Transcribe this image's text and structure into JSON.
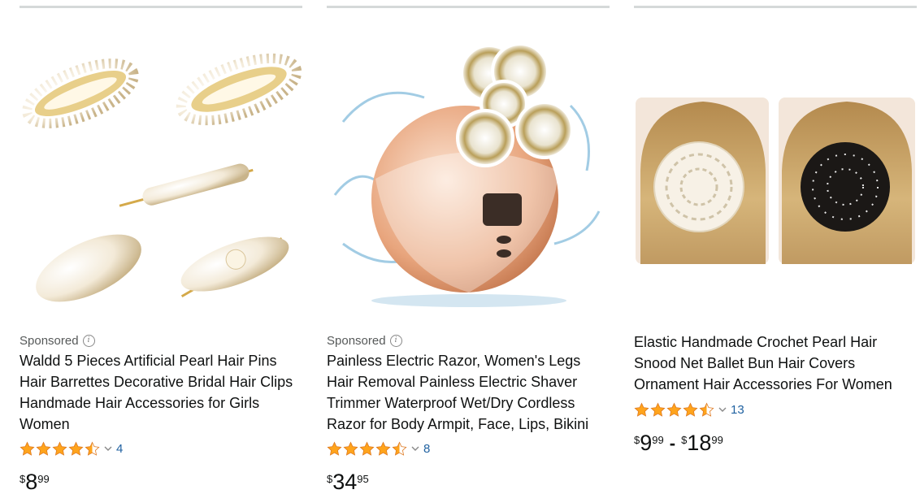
{
  "products": [
    {
      "sponsored_label": "Sponsored",
      "title": "Waldd 5 Pieces Artificial Pearl Hair Pins Hair Barrettes Decorative Bridal Hair Clips Handmade Hair Accessories for Girls Women",
      "rating": 4.5,
      "review_count": "4",
      "price": {
        "symbol": "$",
        "whole": "8",
        "fraction": "99"
      },
      "image_icon": "pearl-hair-clips-image"
    },
    {
      "sponsored_label": "Sponsored",
      "title": "Painless Electric Razor, Women's Legs Hair Removal Painless Electric Shaver Trimmer Waterproof Wet/Dry Cordless Razor for Body Armpit, Face, Lips, Bikini",
      "rating": 4.5,
      "review_count": "8",
      "price": {
        "symbol": "$",
        "whole": "34",
        "fraction": "95"
      },
      "image_icon": "electric-shaver-image"
    },
    {
      "title": "Elastic Handmade Crochet Pearl Hair Snood Net Ballet Bun Hair Covers Ornament Hair Accessories For Women",
      "rating": 4.5,
      "review_count": "13",
      "price_range": {
        "low": {
          "symbol": "$",
          "whole": "9",
          "fraction": "99"
        },
        "separator": "-",
        "high": {
          "symbol": "$",
          "whole": "18",
          "fraction": "99"
        }
      },
      "image_icon": "hair-snood-image"
    }
  ],
  "colors": {
    "star": "#ffa41c",
    "link": "#2162a1",
    "text": "#0f1111",
    "muted": "#565959",
    "divider": "#d5d9d9"
  }
}
